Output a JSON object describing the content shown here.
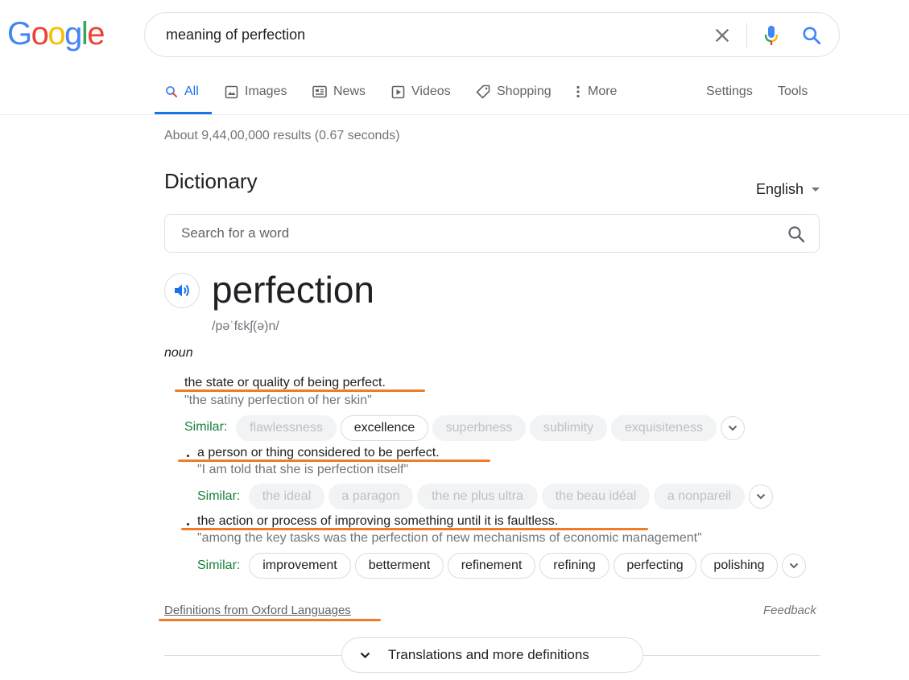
{
  "logo": {
    "letters": [
      "G",
      "o",
      "o",
      "g",
      "l",
      "e"
    ],
    "colors": [
      "#4285f4",
      "#ea4335",
      "#fbbc05",
      "#4285f4",
      "#34a853",
      "#ea4335"
    ]
  },
  "search": {
    "query": "meaning of perfection",
    "clear_icon": "close-icon",
    "mic_icon": "mic-icon",
    "search_icon": "search-icon"
  },
  "tabs": {
    "all": "All",
    "images": "Images",
    "news": "News",
    "videos": "Videos",
    "shopping": "Shopping",
    "more": "More",
    "settings": "Settings",
    "tools": "Tools",
    "active": "All",
    "accent": "#1a73e8"
  },
  "stats": "About 9,44,00,000 results (0.67 seconds)",
  "dictionary": {
    "title": "Dictionary",
    "language": "English",
    "search_placeholder": "Search for a word",
    "word": "perfection",
    "phonetic": "/pəˈfɛkʃ(ə)n/",
    "part_of_speech": "noun",
    "senses": [
      {
        "definition": "the state or quality of being perfect.",
        "example": "\"the satiny perfection of her skin\"",
        "similar_label": "Similar:",
        "similar": [
          "flawlessness",
          "excellence",
          "superbness",
          "sublimity",
          "exquisiteness"
        ]
      },
      {
        "definition": "a person or thing considered to be perfect.",
        "example": "\"I am told that she is perfection itself\"",
        "similar_label": "Similar:",
        "similar": [
          "the ideal",
          "a paragon",
          "the ne plus ultra",
          "the beau idéal",
          "a nonpareil"
        ]
      },
      {
        "definition": "the action or process of improving something until it is faultless.",
        "example": "\"among the key tasks was the perfection of new mechanisms of economic management\"",
        "similar_label": "Similar:",
        "similar": [
          "improvement",
          "betterment",
          "refinement",
          "refining",
          "perfecting",
          "polishing"
        ]
      }
    ],
    "source": "Definitions from Oxford Languages",
    "feedback": "Feedback",
    "translations_button": "Translations and more definitions",
    "annotation_color": "#f07c27"
  }
}
